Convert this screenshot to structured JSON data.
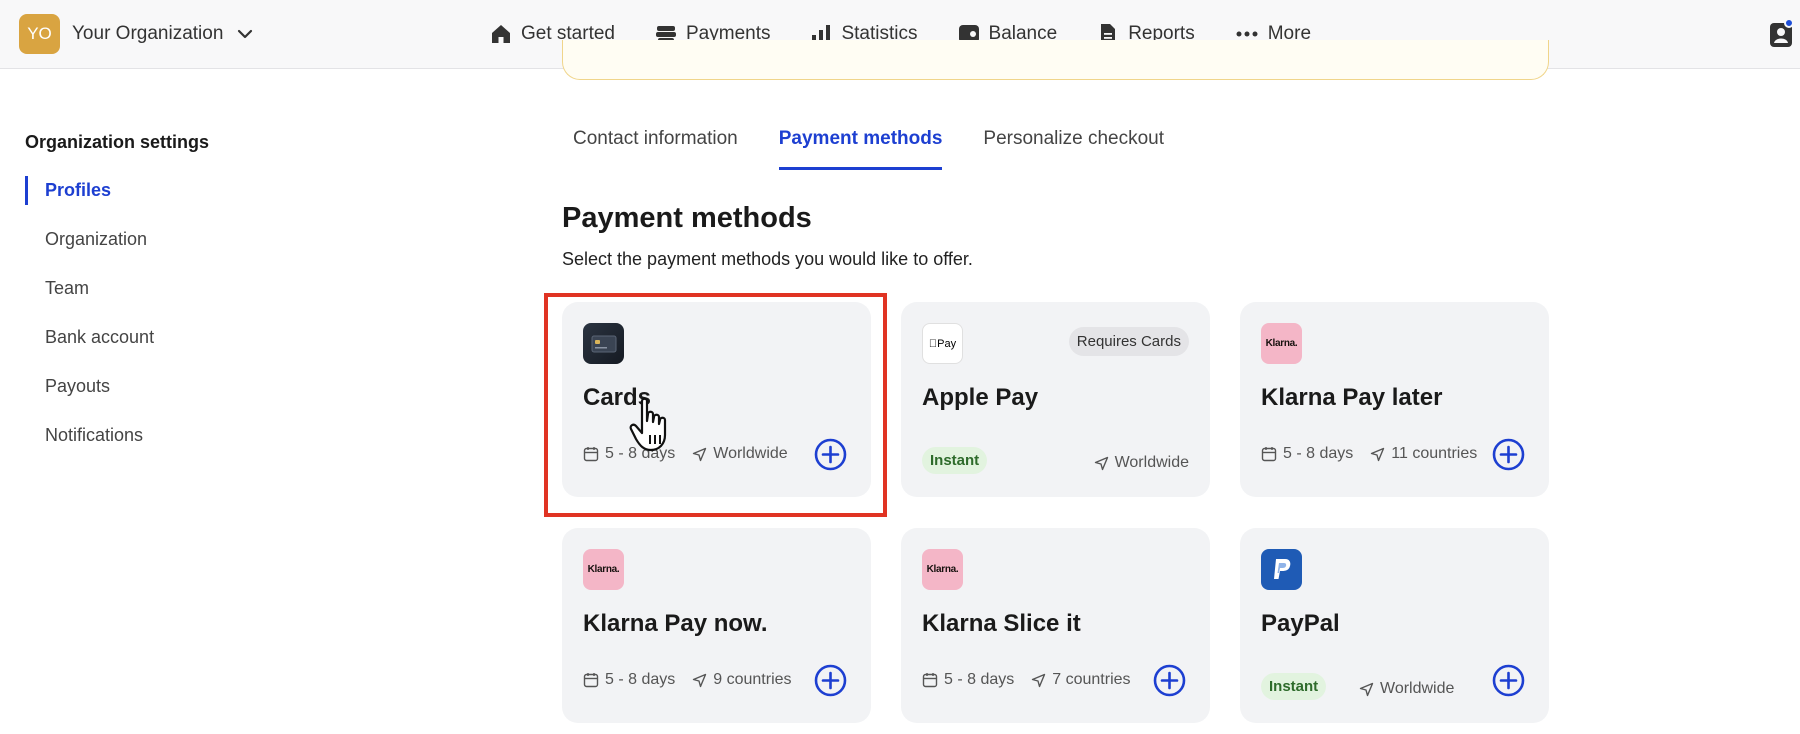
{
  "org": {
    "initials": "YO",
    "name": "Your Organization"
  },
  "nav": [
    {
      "label": "Get started",
      "icon": "home-icon"
    },
    {
      "label": "Payments",
      "icon": "payments-icon"
    },
    {
      "label": "Statistics",
      "icon": "statistics-icon"
    },
    {
      "label": "Balance",
      "icon": "balance-icon"
    },
    {
      "label": "Reports",
      "icon": "reports-icon"
    },
    {
      "label": "More",
      "icon": "more-icon"
    }
  ],
  "sidebar": {
    "title": "Organization settings",
    "items": [
      "Profiles",
      "Organization",
      "Team",
      "Bank account",
      "Payouts",
      "Notifications"
    ],
    "active": "Profiles"
  },
  "tabs": [
    "Contact information",
    "Payment methods",
    "Personalize checkout"
  ],
  "active_tab": "Payment methods",
  "section": {
    "title": "Payment methods",
    "subtitle": "Select the payment methods you would like to offer."
  },
  "methods": [
    {
      "name": "Cards",
      "logo": "card-icon",
      "days": "5 - 8 days",
      "region": "Worldwide"
    },
    {
      "name": "Apple Pay",
      "logo_text": "Pay",
      "badge": "Requires Cards",
      "tag": "Instant",
      "region": "Worldwide"
    },
    {
      "name": "Klarna Pay later",
      "logo_text": "Klarna.",
      "days": "5 - 8 days",
      "region": "11 countries"
    },
    {
      "name": "Klarna Pay now.",
      "logo_text": "Klarna.",
      "days": "5 - 8 days",
      "region": "9 countries"
    },
    {
      "name": "Klarna Slice it",
      "logo_text": "Klarna.",
      "days": "5 - 8 days",
      "region": "7 countries"
    },
    {
      "name": "PayPal",
      "logo": "paypal-icon",
      "tag": "Instant",
      "region": "Worldwide"
    }
  ],
  "colors": {
    "accent": "#1d3fd1",
    "highlight": "#e03323",
    "klarna": "#f4b6c7",
    "paypal": "#1f5bb5",
    "instant_bg": "#e2f3df"
  }
}
